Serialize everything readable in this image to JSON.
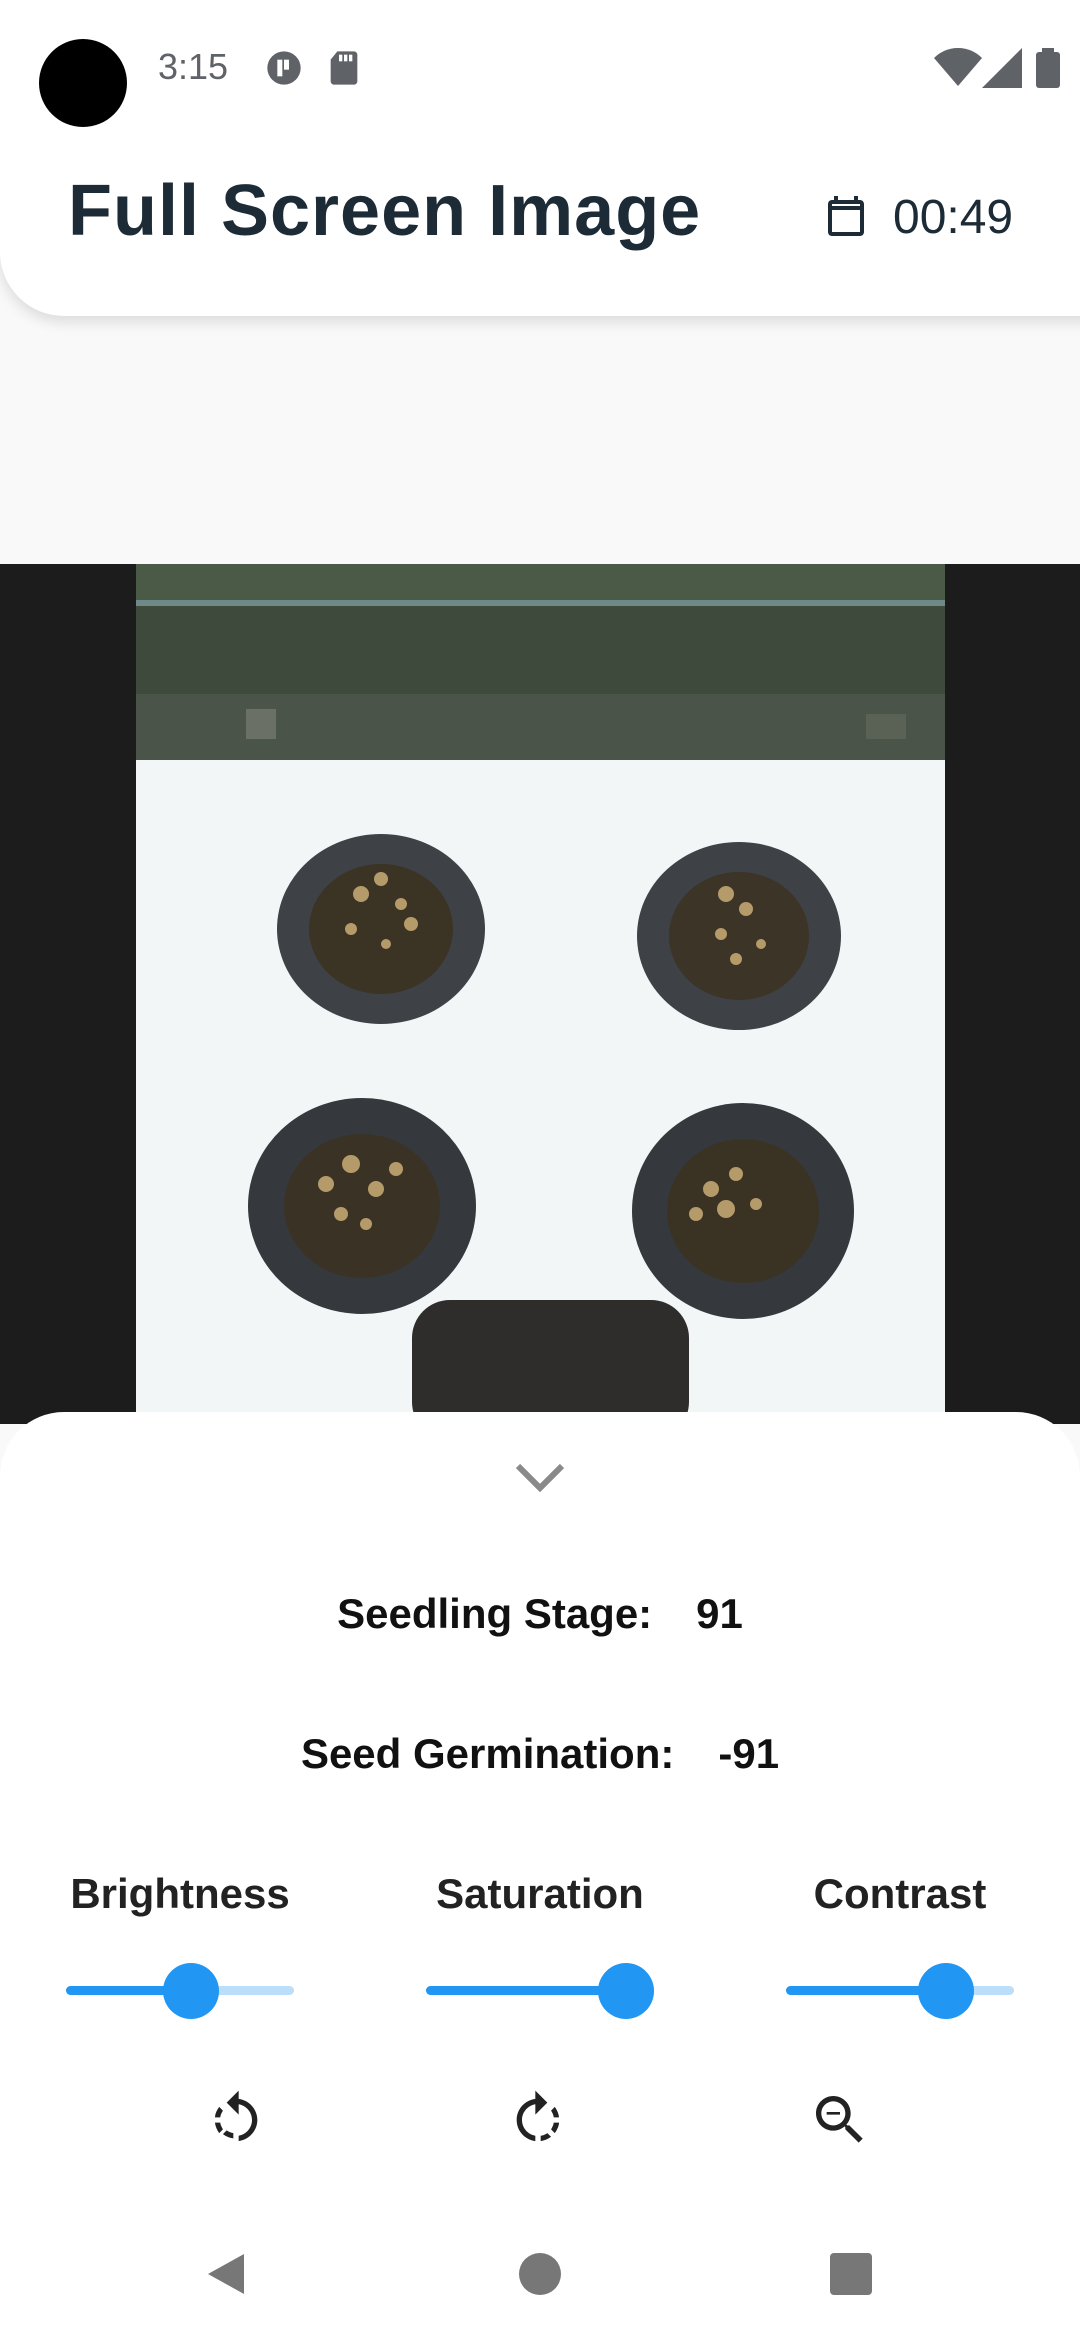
{
  "status_bar": {
    "time": "3:15",
    "icons": [
      "app-notification-icon",
      "sd-card-icon",
      "wifi-icon",
      "signal-icon",
      "battery-icon"
    ]
  },
  "header": {
    "title": "Full Screen Image",
    "icon": "calendar-icon",
    "time": "00:49"
  },
  "image": {
    "description_icon": "seedling-tray-photo"
  },
  "sheet": {
    "collapse_icon": "chevron-down-icon",
    "seedling_stage_label": "Seedling Stage:",
    "seedling_stage_value": "91",
    "seed_germination_label": "Seed Germination:",
    "seed_germination_value": "-91",
    "controls": [
      {
        "label": "Brightness",
        "value": 0.55
      },
      {
        "label": "Saturation",
        "value": 1.0
      },
      {
        "label": "Contrast",
        "value": 0.7
      }
    ],
    "tools": [
      "rotate-left-icon",
      "rotate-right-icon",
      "zoom-out-icon"
    ]
  },
  "nav_bar": {
    "icons": [
      "back-icon",
      "home-icon",
      "recents-icon"
    ]
  },
  "colors": {
    "accent": "#2196f3",
    "accent_light": "#bbdefb",
    "title": "#1c2b36"
  }
}
